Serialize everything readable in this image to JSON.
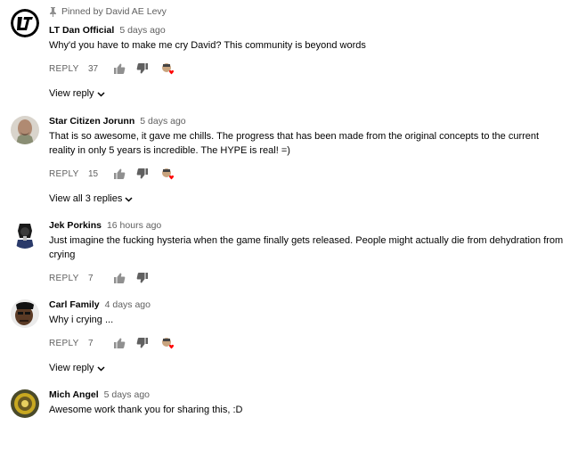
{
  "pinned_label": "Pinned by David AE Levy",
  "reply_label": "REPLY",
  "comments": [
    {
      "author": "LT Dan Official",
      "time": "5 days ago",
      "text": "Why'd you have to make me cry David?  This community is beyond words",
      "likes": "37",
      "view_replies": "View reply"
    },
    {
      "author": "Star Citizen Jorunn",
      "time": "5 days ago",
      "text": "That is so awesome, it gave me chills.  The progress that has been made from the original concepts to the current reality in only 5 years is incredible. The HYPE is real! =)",
      "likes": "15",
      "view_replies": "View all 3 replies"
    },
    {
      "author": "Jek Porkins",
      "time": "16 hours ago",
      "text": "Just imagine the fucking hysteria when the game finally gets released.  People might actually die from dehydration from crying",
      "likes": "7"
    },
    {
      "author": "Carl Family",
      "time": "4 days ago",
      "text": "Why i crying ...",
      "likes": "7",
      "view_replies": "View reply"
    },
    {
      "author": "Mich Angel",
      "time": "5 days ago",
      "text": "Awesome work thank you for sharing this, :D"
    }
  ],
  "icons": {
    "pin": "pin-icon",
    "like": "thumb-up-icon",
    "dislike": "thumb-down-icon",
    "creator_heart": "creator-heart-icon",
    "expand": "chevron-down-icon"
  },
  "colors": {
    "text": "#030303",
    "secondary": "#606060",
    "heart": "#ff0000"
  }
}
